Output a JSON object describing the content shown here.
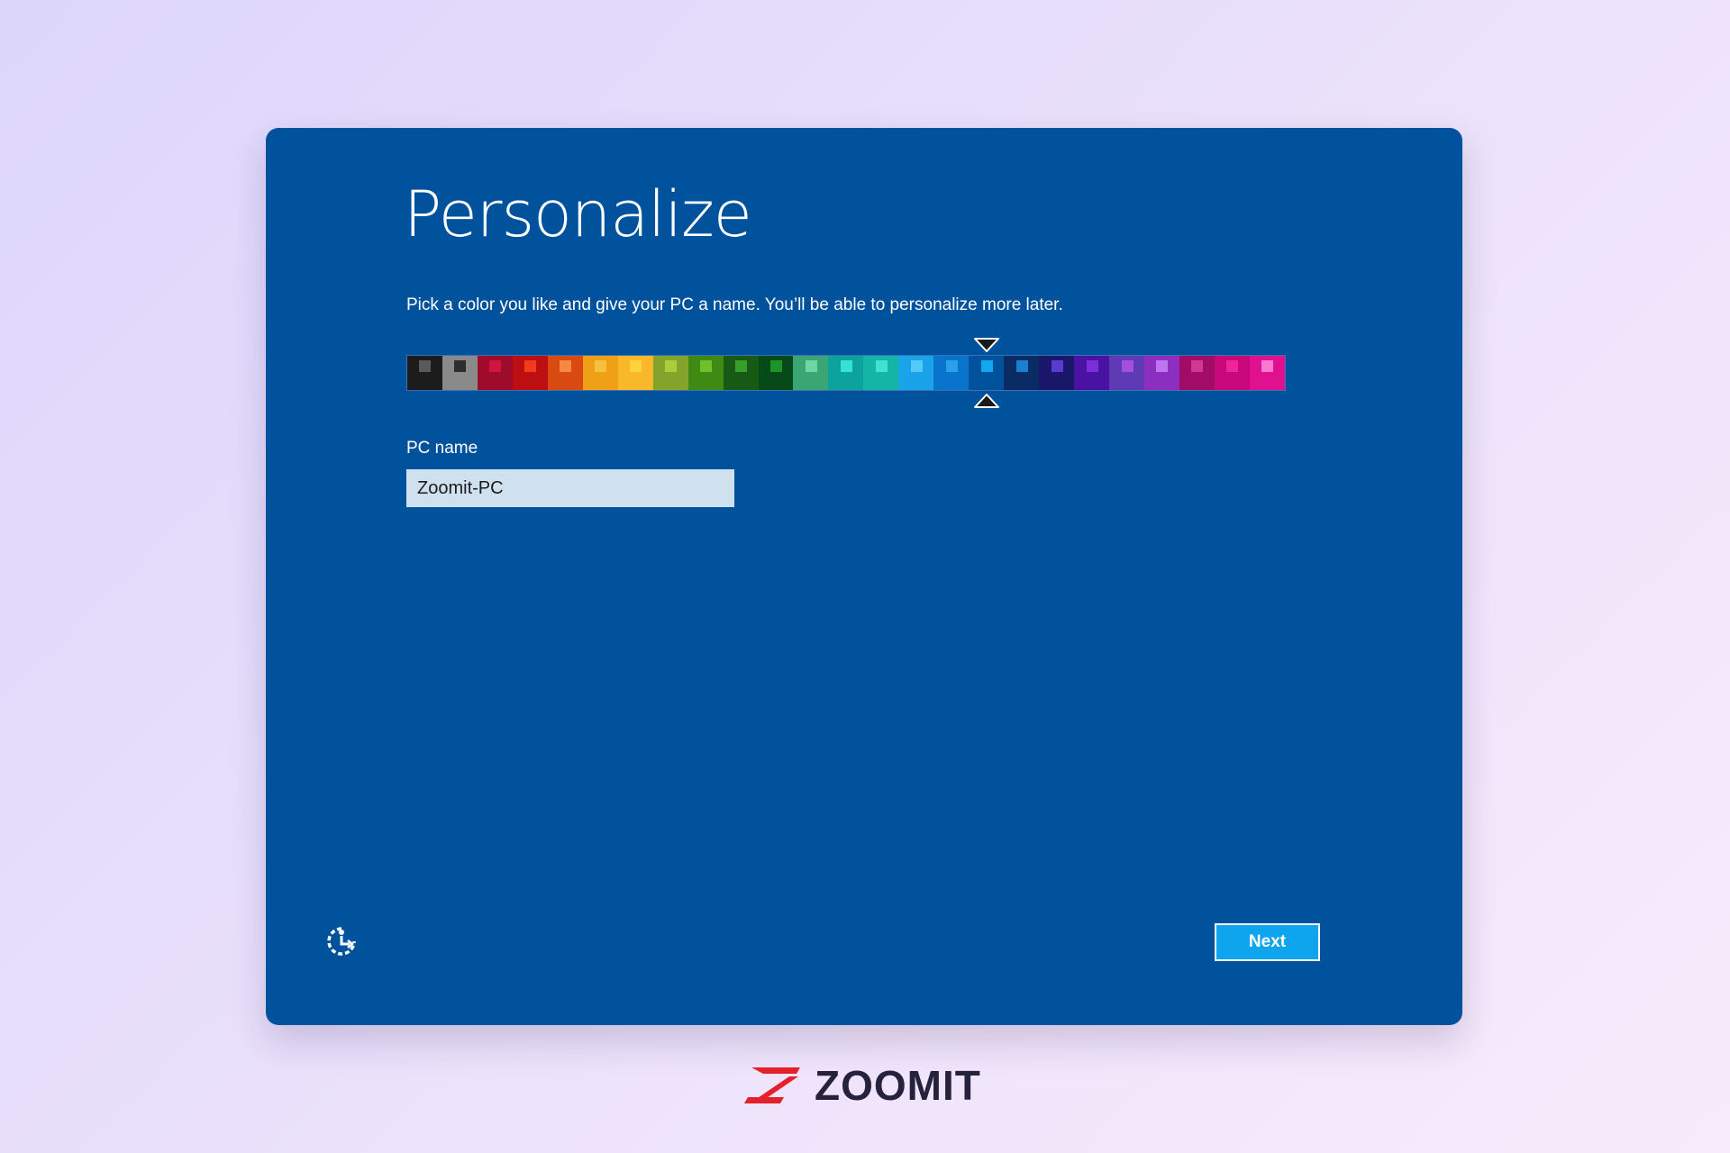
{
  "window": {
    "title": "Personalize",
    "subtitle": "Pick a color you like and give your PC a name. You’ll be able to personalize more later."
  },
  "palette": {
    "selected_index": 16,
    "swatches": [
      {
        "base": "#1c1c1c",
        "accent": "#5a5a5a"
      },
      {
        "base": "#8a8a8a",
        "accent": "#2e2e2e"
      },
      {
        "base": "#9f0b2b",
        "accent": "#d0153b"
      },
      {
        "base": "#bd0e12",
        "accent": "#f23a1c"
      },
      {
        "base": "#d94a12",
        "accent": "#f7883f"
      },
      {
        "base": "#f0a017",
        "accent": "#f7c13f"
      },
      {
        "base": "#f9b72a",
        "accent": "#fbd33c"
      },
      {
        "base": "#84a32a",
        "accent": "#a8cf3b"
      },
      {
        "base": "#3f8a12",
        "accent": "#6ec12b"
      },
      {
        "base": "#175a15",
        "accent": "#36a02b"
      },
      {
        "base": "#064a19",
        "accent": "#1c9429"
      },
      {
        "base": "#3aa673",
        "accent": "#6fd6a0"
      },
      {
        "base": "#0ba39b",
        "accent": "#36e0d4"
      },
      {
        "base": "#12b5a6",
        "accent": "#43e0cf"
      },
      {
        "base": "#1aa3e8",
        "accent": "#55c9f7"
      },
      {
        "base": "#0a73cc",
        "accent": "#2aa0ea"
      },
      {
        "base": "#00529c",
        "accent": "#11a8f0"
      },
      {
        "base": "#0b2b64",
        "accent": "#1b7ed1"
      },
      {
        "base": "#1a166a",
        "accent": "#5a3bd0"
      },
      {
        "base": "#4a12a3",
        "accent": "#7a2fd8"
      },
      {
        "base": "#5e3ab4",
        "accent": "#a24fe0"
      },
      {
        "base": "#8c2fc0",
        "accent": "#c074ee"
      },
      {
        "base": "#a10c68",
        "accent": "#d2398e"
      },
      {
        "base": "#c8087a",
        "accent": "#f0259b"
      },
      {
        "base": "#e0118e",
        "accent": "#fa7ad0"
      }
    ]
  },
  "pc_name": {
    "label": "PC name",
    "value": "Zoomit-PC"
  },
  "footer": {
    "next_label": "Next"
  },
  "brand": {
    "name": "ZOOMIT",
    "logo_color": "#e3202c"
  },
  "icons": {
    "ease_of_access": "ease-of-access-icon",
    "marker_top": "triangle-down-icon",
    "marker_bottom": "triangle-up-icon"
  }
}
